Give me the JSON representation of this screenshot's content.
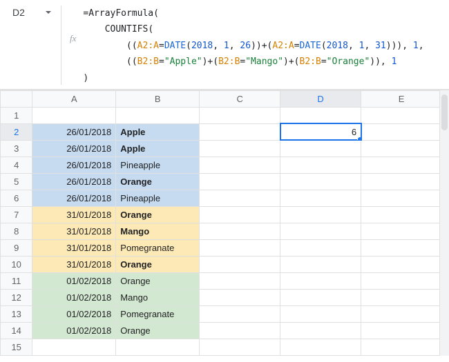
{
  "name_box": {
    "cell_ref": "D2"
  },
  "fx_label": "fx",
  "formula": {
    "line1_eq": "=",
    "line1_fn": "ArrayFormula",
    "line1_open": "(",
    "line2_indent": "    ",
    "line2_fn": "COUNTIFS",
    "line2_open": "(",
    "line3_indent": "        ",
    "line3_p1": "((",
    "line3_ref1": "A2:A",
    "line3_eq1": "=",
    "line3_date1": "DATE",
    "line3_d1o": "(",
    "line3_y1": "2018",
    "line3_c1": ", ",
    "line3_m1": "1",
    "line3_c2": ", ",
    "line3_dd1": "26",
    "line3_d1c": "))+(",
    "line3_ref2": "A2:A",
    "line3_eq2": "=",
    "line3_date2": "DATE",
    "line3_d2o": "(",
    "line3_y2": "2018",
    "line3_c3": ", ",
    "line3_m2": "1",
    "line3_c4": ", ",
    "line3_dd2": "31",
    "line3_d2c": "))), ",
    "line3_one": "1",
    "line3_end": ",",
    "line4_indent": "        ",
    "line4_p1": "((",
    "line4_ref1": "B2:B",
    "line4_eq1": "=",
    "line4_s1": "\"Apple\"",
    "line4_pl1": ")+(",
    "line4_ref2": "B2:B",
    "line4_eq2": "=",
    "line4_s2": "\"Mango\"",
    "line4_pl2": ")+(",
    "line4_ref3": "B2:B",
    "line4_eq3": "=",
    "line4_s3": "\"Orange\"",
    "line4_p2": ")), ",
    "line4_one": "1",
    "line5_close": ")"
  },
  "columns": [
    "A",
    "B",
    "C",
    "D",
    "E"
  ],
  "active_column_index": 3,
  "active_row_index": 1,
  "selected_cell_value": "6",
  "rows": [
    {
      "num": "1",
      "bg": "",
      "a": "",
      "b": "",
      "bold": false
    },
    {
      "num": "2",
      "bg": "blue",
      "a": "26/01/2018",
      "b": "Apple",
      "bold": true
    },
    {
      "num": "3",
      "bg": "blue",
      "a": "26/01/2018",
      "b": "Apple",
      "bold": true
    },
    {
      "num": "4",
      "bg": "blue",
      "a": "26/01/2018",
      "b": "Pineapple",
      "bold": false
    },
    {
      "num": "5",
      "bg": "blue",
      "a": "26/01/2018",
      "b": "Orange",
      "bold": true
    },
    {
      "num": "6",
      "bg": "blue",
      "a": "26/01/2018",
      "b": "Pineapple",
      "bold": false
    },
    {
      "num": "7",
      "bg": "yellow",
      "a": "31/01/2018",
      "b": "Orange",
      "bold": true
    },
    {
      "num": "8",
      "bg": "yellow",
      "a": "31/01/2018",
      "b": "Mango",
      "bold": true
    },
    {
      "num": "9",
      "bg": "yellow",
      "a": "31/01/2018",
      "b": "Pomegranate",
      "bold": false
    },
    {
      "num": "10",
      "bg": "yellow",
      "a": "31/01/2018",
      "b": "Orange",
      "bold": true
    },
    {
      "num": "11",
      "bg": "green",
      "a": "01/02/2018",
      "b": "Orange",
      "bold": false
    },
    {
      "num": "12",
      "bg": "green",
      "a": "01/02/2018",
      "b": "Mango",
      "bold": false
    },
    {
      "num": "13",
      "bg": "green",
      "a": "01/02/2018",
      "b": "Pomegranate",
      "bold": false
    },
    {
      "num": "14",
      "bg": "green",
      "a": "01/02/2018",
      "b": "Orange",
      "bold": false
    },
    {
      "num": "15",
      "bg": "",
      "a": "",
      "b": "",
      "bold": false
    }
  ]
}
